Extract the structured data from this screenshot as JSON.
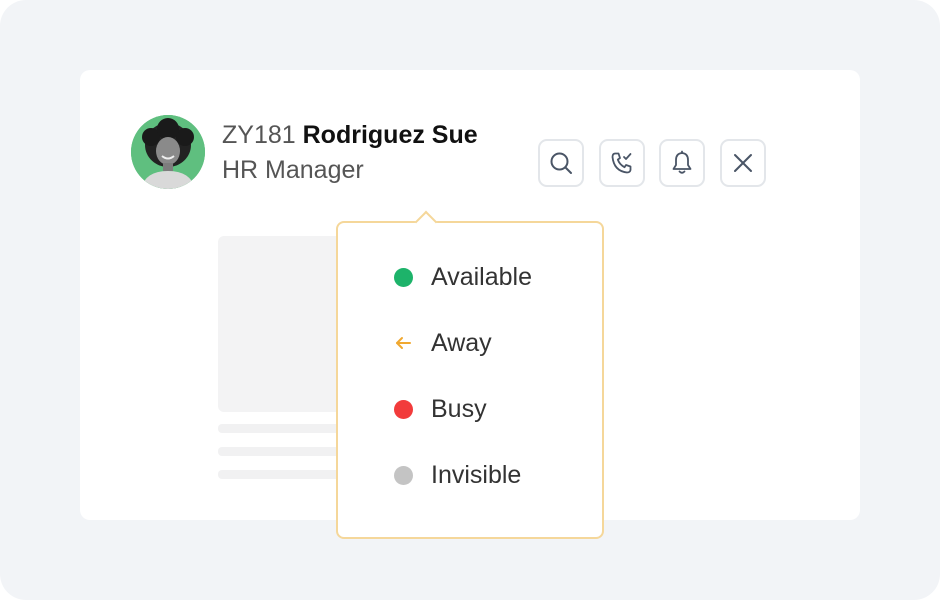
{
  "profile": {
    "id": "ZY181",
    "name": "Rodriguez Sue",
    "role": "HR Manager"
  },
  "actions": [
    {
      "icon": "search-icon"
    },
    {
      "icon": "phone-check-icon"
    },
    {
      "icon": "bell-icon"
    },
    {
      "icon": "close-icon"
    }
  ],
  "status_menu": {
    "items": [
      {
        "label": "Available",
        "icon": "status-dot-icon",
        "color": "#1db36a"
      },
      {
        "label": "Away",
        "icon": "arrow-left-icon",
        "color": "#f0a830"
      },
      {
        "label": "Busy",
        "icon": "status-dot-icon",
        "color": "#f23b3b"
      },
      {
        "label": "Invisible",
        "icon": "status-dot-icon",
        "color": "#c4c4c4"
      }
    ]
  },
  "colors": {
    "popover_border": "#f5d79a",
    "background": "#f2f4f7"
  }
}
